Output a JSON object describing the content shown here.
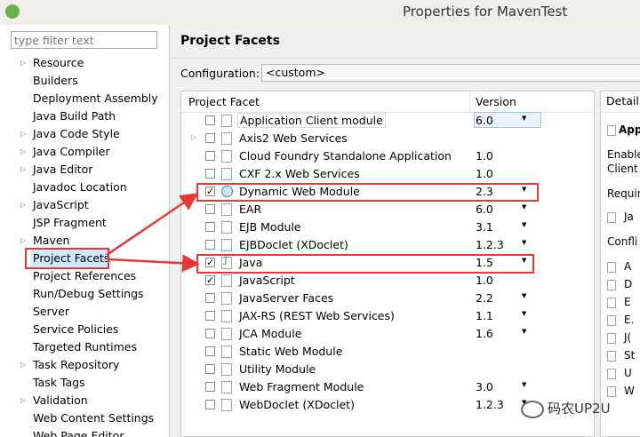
{
  "window": {
    "title": "Properties for MavenTest"
  },
  "sidebar": {
    "filter_placeholder": "type filter text",
    "items": [
      {
        "label": "Resource",
        "expandable": true
      },
      {
        "label": "Builders",
        "expandable": false
      },
      {
        "label": "Deployment Assembly",
        "expandable": false
      },
      {
        "label": "Java Build Path",
        "expandable": false
      },
      {
        "label": "Java Code Style",
        "expandable": true
      },
      {
        "label": "Java Compiler",
        "expandable": true
      },
      {
        "label": "Java Editor",
        "expandable": true
      },
      {
        "label": "Javadoc Location",
        "expandable": false
      },
      {
        "label": "JavaScript",
        "expandable": true
      },
      {
        "label": "JSP Fragment",
        "expandable": false
      },
      {
        "label": "Maven",
        "expandable": true
      },
      {
        "label": "Project Facets",
        "expandable": false,
        "selected": true
      },
      {
        "label": "Project References",
        "expandable": false
      },
      {
        "label": "Run/Debug Settings",
        "expandable": false
      },
      {
        "label": "Server",
        "expandable": false
      },
      {
        "label": "Service Policies",
        "expandable": false
      },
      {
        "label": "Targeted Runtimes",
        "expandable": false
      },
      {
        "label": "Task Repository",
        "expandable": true
      },
      {
        "label": "Task Tags",
        "expandable": false
      },
      {
        "label": "Validation",
        "expandable": true
      },
      {
        "label": "Web Content Settings",
        "expandable": false
      },
      {
        "label": "Web Page Editor",
        "expandable": false
      }
    ]
  },
  "main": {
    "title": "Project Facets",
    "configuration_label": "Configuration:",
    "configuration_value": "<custom>",
    "columns": {
      "facet": "Project Facet",
      "version": "Version"
    },
    "facets": [
      {
        "name": "Application Client module",
        "checked": false,
        "version": "6.0",
        "dropdown": true,
        "icon": "doc-icon"
      },
      {
        "name": "Axis2 Web Services",
        "checked": false,
        "version": "",
        "dropdown": false,
        "icon": "doc-icon",
        "expandable": true
      },
      {
        "name": "Cloud Foundry Standalone Application",
        "checked": false,
        "version": "1.0",
        "dropdown": false,
        "icon": "doc-icon"
      },
      {
        "name": "CXF 2.x Web Services",
        "checked": false,
        "version": "1.0",
        "dropdown": false,
        "icon": "doc-icon"
      },
      {
        "name": "Dynamic Web Module",
        "checked": true,
        "version": "2.3",
        "dropdown": true,
        "icon": "globe-icon"
      },
      {
        "name": "EAR",
        "checked": false,
        "version": "6.0",
        "dropdown": true,
        "icon": "doc-icon"
      },
      {
        "name": "EJB Module",
        "checked": false,
        "version": "3.1",
        "dropdown": true,
        "icon": "doc-icon"
      },
      {
        "name": "EJBDoclet (XDoclet)",
        "checked": false,
        "version": "1.2.3",
        "dropdown": true,
        "icon": "doc-icon"
      },
      {
        "name": "Java",
        "checked": true,
        "version": "1.5",
        "dropdown": true,
        "icon": "java-icon"
      },
      {
        "name": "JavaScript",
        "checked": true,
        "version": "1.0",
        "dropdown": false,
        "icon": "doc-icon"
      },
      {
        "name": "JavaServer Faces",
        "checked": false,
        "version": "2.2",
        "dropdown": true,
        "icon": "doc-icon"
      },
      {
        "name": "JAX-RS (REST Web Services)",
        "checked": false,
        "version": "1.1",
        "dropdown": true,
        "icon": "doc-icon"
      },
      {
        "name": "JCA Module",
        "checked": false,
        "version": "1.6",
        "dropdown": true,
        "icon": "doc-icon"
      },
      {
        "name": "Static Web Module",
        "checked": false,
        "version": "",
        "dropdown": false,
        "icon": "doc-icon"
      },
      {
        "name": "Utility Module",
        "checked": false,
        "version": "",
        "dropdown": false,
        "icon": "doc-icon"
      },
      {
        "name": "Web Fragment Module",
        "checked": false,
        "version": "3.0",
        "dropdown": true,
        "icon": "doc-icon"
      },
      {
        "name": "WebDoclet (XDoclet)",
        "checked": false,
        "version": "1.2.3",
        "dropdown": true,
        "icon": "doc-icon"
      }
    ]
  },
  "detail": {
    "tab": "Detail",
    "heading": "Applic",
    "desc_1": "Enable",
    "desc_2": "Client",
    "requires": "Requir",
    "req_item": "Ja",
    "conflicts": "Confli",
    "conflict_items": [
      "A",
      "D",
      "E",
      "E.",
      "J(",
      "St",
      "U",
      "W"
    ]
  },
  "watermark": "码农UP2U",
  "colors": {
    "highlight": "#e53935",
    "selection": "#cde8ff"
  }
}
